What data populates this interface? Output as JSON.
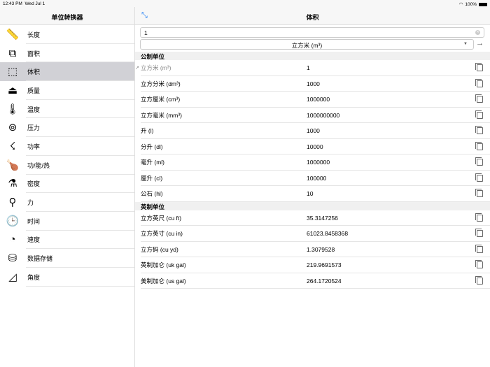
{
  "status": {
    "time": "12:43 PM",
    "date": "Wed Jul 1",
    "battery": "100%"
  },
  "sidebar": {
    "title": "单位转换器",
    "items": [
      {
        "label": "长度",
        "icon": "ruler-icon",
        "glyph": "📏"
      },
      {
        "label": "面积",
        "icon": "crop-icon",
        "glyph": "⧉"
      },
      {
        "label": "体积",
        "icon": "cube-icon",
        "glyph": "⬚"
      },
      {
        "label": "质量",
        "icon": "weight-icon",
        "glyph": "⏏"
      },
      {
        "label": "温度",
        "icon": "thermometer-icon",
        "glyph": "🌡"
      },
      {
        "label": "压力",
        "icon": "gauge-icon",
        "glyph": "⊚"
      },
      {
        "label": "功率",
        "icon": "bulb-icon",
        "glyph": "☇"
      },
      {
        "label": "功/能/热",
        "icon": "drumstick-icon",
        "glyph": "🍗"
      },
      {
        "label": "密度",
        "icon": "beaker-icon",
        "glyph": "⚗"
      },
      {
        "label": "力",
        "icon": "force-icon",
        "glyph": "⚲"
      },
      {
        "label": "时间",
        "icon": "clock-icon",
        "glyph": "🕒"
      },
      {
        "label": "速度",
        "icon": "speedometer-icon",
        "glyph": "◔"
      },
      {
        "label": "数据存储",
        "icon": "database-icon",
        "glyph": "⛁"
      },
      {
        "label": "角度",
        "icon": "angle-icon",
        "glyph": "◿"
      }
    ]
  },
  "main": {
    "title": "体积",
    "input_value": "1",
    "unit_selected": "立方米 (m³)",
    "sections": [
      {
        "title": "公制单位",
        "rows": [
          {
            "name": "立方米 (m³)",
            "value": "1"
          },
          {
            "name": "立方分米 (dm³)",
            "value": "1000"
          },
          {
            "name": "立方厘米 (cm³)",
            "value": "1000000"
          },
          {
            "name": "立方毫米 (mm³)",
            "value": "1000000000"
          },
          {
            "name": "升 (l)",
            "value": "1000"
          },
          {
            "name": "分升 (dl)",
            "value": "10000"
          },
          {
            "name": "毫升 (ml)",
            "value": "1000000"
          },
          {
            "name": "厘升 (cl)",
            "value": "100000"
          },
          {
            "name": "公石 (hl)",
            "value": "10"
          }
        ]
      },
      {
        "title": "英制单位",
        "rows": [
          {
            "name": "立方英尺 (cu ft)",
            "value": "35.3147256"
          },
          {
            "name": "立方英寸 (cu in)",
            "value": "61023.8458368"
          },
          {
            "name": "立方码 (cu yd)",
            "value": "1.3079528"
          },
          {
            "name": "英制加仑 (uk gal)",
            "value": "219.9691573"
          },
          {
            "name": "美制加仑 (us gal)",
            "value": "264.1720524"
          }
        ]
      }
    ]
  }
}
